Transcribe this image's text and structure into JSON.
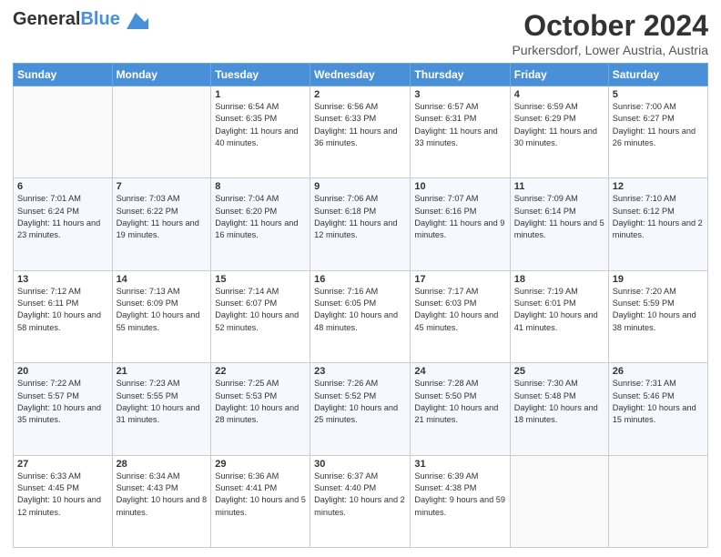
{
  "header": {
    "logo_general": "General",
    "logo_blue": "Blue",
    "month_title": "October 2024",
    "location": "Purkersdorf, Lower Austria, Austria"
  },
  "weekdays": [
    "Sunday",
    "Monday",
    "Tuesday",
    "Wednesday",
    "Thursday",
    "Friday",
    "Saturday"
  ],
  "weeks": [
    [
      {
        "day": "",
        "info": ""
      },
      {
        "day": "",
        "info": ""
      },
      {
        "day": "1",
        "info": "Sunrise: 6:54 AM\nSunset: 6:35 PM\nDaylight: 11 hours\nand 40 minutes."
      },
      {
        "day": "2",
        "info": "Sunrise: 6:56 AM\nSunset: 6:33 PM\nDaylight: 11 hours\nand 36 minutes."
      },
      {
        "day": "3",
        "info": "Sunrise: 6:57 AM\nSunset: 6:31 PM\nDaylight: 11 hours\nand 33 minutes."
      },
      {
        "day": "4",
        "info": "Sunrise: 6:59 AM\nSunset: 6:29 PM\nDaylight: 11 hours\nand 30 minutes."
      },
      {
        "day": "5",
        "info": "Sunrise: 7:00 AM\nSunset: 6:27 PM\nDaylight: 11 hours\nand 26 minutes."
      }
    ],
    [
      {
        "day": "6",
        "info": "Sunrise: 7:01 AM\nSunset: 6:24 PM\nDaylight: 11 hours\nand 23 minutes."
      },
      {
        "day": "7",
        "info": "Sunrise: 7:03 AM\nSunset: 6:22 PM\nDaylight: 11 hours\nand 19 minutes."
      },
      {
        "day": "8",
        "info": "Sunrise: 7:04 AM\nSunset: 6:20 PM\nDaylight: 11 hours\nand 16 minutes."
      },
      {
        "day": "9",
        "info": "Sunrise: 7:06 AM\nSunset: 6:18 PM\nDaylight: 11 hours\nand 12 minutes."
      },
      {
        "day": "10",
        "info": "Sunrise: 7:07 AM\nSunset: 6:16 PM\nDaylight: 11 hours\nand 9 minutes."
      },
      {
        "day": "11",
        "info": "Sunrise: 7:09 AM\nSunset: 6:14 PM\nDaylight: 11 hours\nand 5 minutes."
      },
      {
        "day": "12",
        "info": "Sunrise: 7:10 AM\nSunset: 6:12 PM\nDaylight: 11 hours\nand 2 minutes."
      }
    ],
    [
      {
        "day": "13",
        "info": "Sunrise: 7:12 AM\nSunset: 6:11 PM\nDaylight: 10 hours\nand 58 minutes."
      },
      {
        "day": "14",
        "info": "Sunrise: 7:13 AM\nSunset: 6:09 PM\nDaylight: 10 hours\nand 55 minutes."
      },
      {
        "day": "15",
        "info": "Sunrise: 7:14 AM\nSunset: 6:07 PM\nDaylight: 10 hours\nand 52 minutes."
      },
      {
        "day": "16",
        "info": "Sunrise: 7:16 AM\nSunset: 6:05 PM\nDaylight: 10 hours\nand 48 minutes."
      },
      {
        "day": "17",
        "info": "Sunrise: 7:17 AM\nSunset: 6:03 PM\nDaylight: 10 hours\nand 45 minutes."
      },
      {
        "day": "18",
        "info": "Sunrise: 7:19 AM\nSunset: 6:01 PM\nDaylight: 10 hours\nand 41 minutes."
      },
      {
        "day": "19",
        "info": "Sunrise: 7:20 AM\nSunset: 5:59 PM\nDaylight: 10 hours\nand 38 minutes."
      }
    ],
    [
      {
        "day": "20",
        "info": "Sunrise: 7:22 AM\nSunset: 5:57 PM\nDaylight: 10 hours\nand 35 minutes."
      },
      {
        "day": "21",
        "info": "Sunrise: 7:23 AM\nSunset: 5:55 PM\nDaylight: 10 hours\nand 31 minutes."
      },
      {
        "day": "22",
        "info": "Sunrise: 7:25 AM\nSunset: 5:53 PM\nDaylight: 10 hours\nand 28 minutes."
      },
      {
        "day": "23",
        "info": "Sunrise: 7:26 AM\nSunset: 5:52 PM\nDaylight: 10 hours\nand 25 minutes."
      },
      {
        "day": "24",
        "info": "Sunrise: 7:28 AM\nSunset: 5:50 PM\nDaylight: 10 hours\nand 21 minutes."
      },
      {
        "day": "25",
        "info": "Sunrise: 7:30 AM\nSunset: 5:48 PM\nDaylight: 10 hours\nand 18 minutes."
      },
      {
        "day": "26",
        "info": "Sunrise: 7:31 AM\nSunset: 5:46 PM\nDaylight: 10 hours\nand 15 minutes."
      }
    ],
    [
      {
        "day": "27",
        "info": "Sunrise: 6:33 AM\nSunset: 4:45 PM\nDaylight: 10 hours\nand 12 minutes."
      },
      {
        "day": "28",
        "info": "Sunrise: 6:34 AM\nSunset: 4:43 PM\nDaylight: 10 hours\nand 8 minutes."
      },
      {
        "day": "29",
        "info": "Sunrise: 6:36 AM\nSunset: 4:41 PM\nDaylight: 10 hours\nand 5 minutes."
      },
      {
        "day": "30",
        "info": "Sunrise: 6:37 AM\nSunset: 4:40 PM\nDaylight: 10 hours\nand 2 minutes."
      },
      {
        "day": "31",
        "info": "Sunrise: 6:39 AM\nSunset: 4:38 PM\nDaylight: 9 hours\nand 59 minutes."
      },
      {
        "day": "",
        "info": ""
      },
      {
        "day": "",
        "info": ""
      }
    ]
  ]
}
